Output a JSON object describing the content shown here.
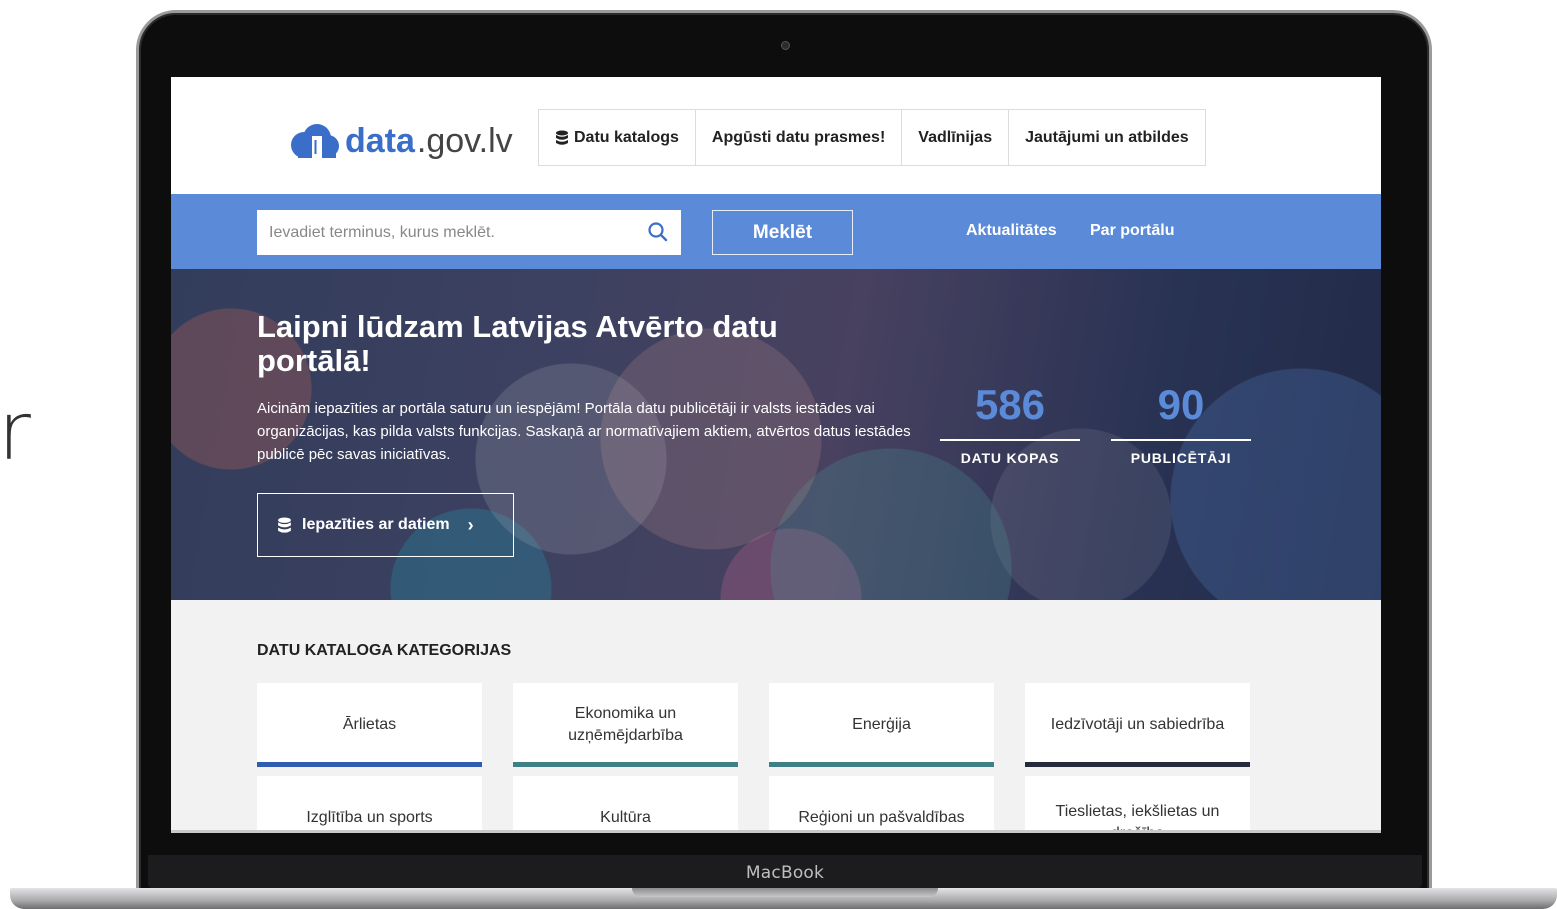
{
  "device": {
    "brand_label": "MacBook"
  },
  "stray_glyph": "r",
  "header": {
    "logo_bold": "data",
    "logo_light": ".gov.lv",
    "nav": [
      {
        "label": "Datu katalogs",
        "icon": "database-icon"
      },
      {
        "label": "Apgūsti datu prasmes!"
      },
      {
        "label": "Vadlīnijas"
      },
      {
        "label": "Jautājumi un atbildes"
      }
    ]
  },
  "search": {
    "placeholder": "Ievadiet terminus, kurus meklēt.",
    "button_label": "Meklēt",
    "links": [
      "Aktualitātes",
      "Par portālu"
    ]
  },
  "hero": {
    "title": "Laipni lūdzam Latvijas Atvērto datu portālā!",
    "description": "Aicinām iepazīties ar portāla saturu un iespējām! Portāla datu publicētāji ir valsts iestādes vai organizācijas, kas pilda valsts funkcijas. Saskaņā ar normatīvajiem aktiem, atvērtos datus iestādes publicē pēc savas iniciatīvas.",
    "button_label": "Iepazīties ar datiem",
    "button_chevron": "›",
    "stats": [
      {
        "value": "586",
        "label": "DATU KOPAS"
      },
      {
        "value": "90",
        "label": "PUBLICĒTĀJI"
      }
    ]
  },
  "categories": {
    "title": "DATU KATALOGA KATEGORIJAS",
    "items": [
      {
        "label": "Ārlietas",
        "color": "#2f5bb3"
      },
      {
        "label": "Ekonomika un uzņēmējdarbība",
        "color": "#3f7f86"
      },
      {
        "label": "Enerģija",
        "color": "#3f7f86"
      },
      {
        "label": "Iedzīvotāji un sabiedrība",
        "color": "#262b3d"
      },
      {
        "label": "Izglītība un sports"
      },
      {
        "label": "Kultūra"
      },
      {
        "label": "Reģioni un pašvaldības"
      },
      {
        "label": "Tieslietas, iekšlietas un drošība"
      }
    ]
  },
  "colors": {
    "accent": "#5b8ad9",
    "logo_blue": "#3a6ec8"
  }
}
